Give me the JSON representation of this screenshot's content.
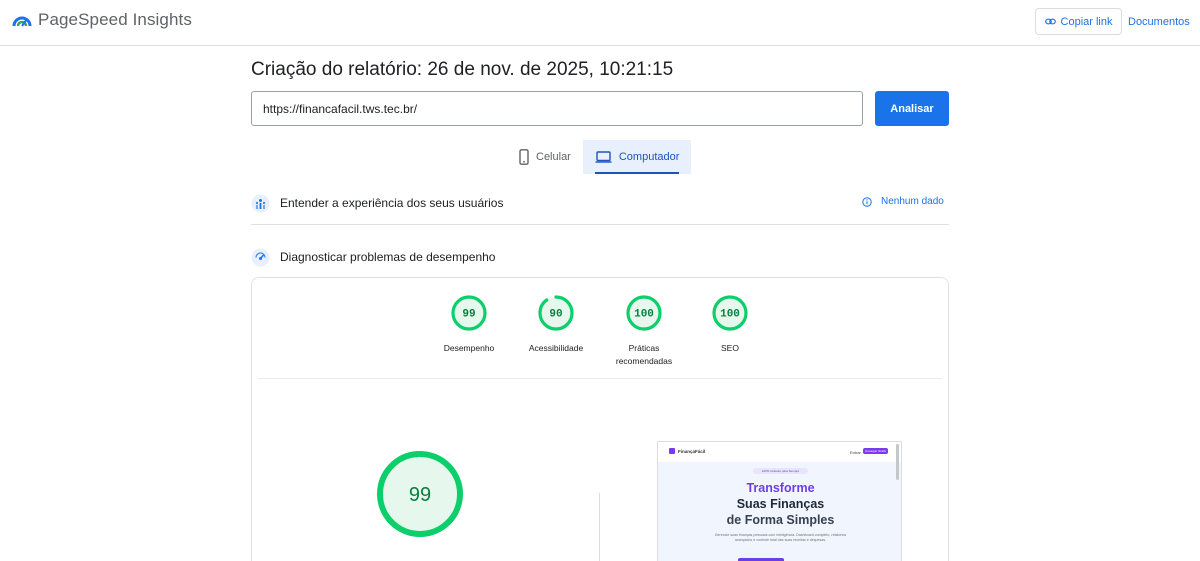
{
  "header": {
    "app_title": "PageSpeed Insights",
    "copy_link_label": "Copiar link",
    "docs_label": "Documentos"
  },
  "report": {
    "title": "Criação do relatório: 26 de nov. de 2025, 10:21:15",
    "url_value": "https://financafacil.tws.tec.br/",
    "analyze_label": "Analisar"
  },
  "tabs": [
    {
      "label": "Celular",
      "icon": "smartphone-icon",
      "active": false
    },
    {
      "label": "Computador",
      "icon": "laptop-icon",
      "active": true
    }
  ],
  "sections": {
    "experience": {
      "label": "Entender a experiência dos seus usuários",
      "icon": "users-experience-icon",
      "status": "Nenhum dado",
      "status_icon": "info-icon"
    },
    "diagnostics": {
      "label": "Diagnosticar problemas de desempenho",
      "icon": "diagnostics-icon"
    }
  },
  "scores": [
    {
      "name": "performance",
      "value": 99,
      "label": "Desempenho"
    },
    {
      "name": "accessibility",
      "value": 90,
      "label": "Acessibilidade"
    },
    {
      "name": "best-practices",
      "value": 100,
      "label": "Práticas recomendadas"
    },
    {
      "name": "seo",
      "value": 100,
      "label": "SEO"
    }
  ],
  "main_score": {
    "value": 99
  },
  "colors": {
    "accent": "#1a73e8",
    "score_good": "#0cce6b",
    "score_good_text": "#08803c",
    "score_good_fill": "#e6f8ee"
  },
  "screenshot": {
    "brand": "FinançaFácil",
    "nav_login": "Entrar",
    "nav_cta": "Começar Grátis",
    "pill": "100% Gratuito para Sempre",
    "headline_1": "Transforme",
    "headline_2": "Suas Finanças",
    "headline_3": "de Forma Simples",
    "subtitle": "Gerencie suas finanças pessoais com inteligência. Dashboard completo, relatórios avançados e controle total das suas receitas e despesas."
  }
}
